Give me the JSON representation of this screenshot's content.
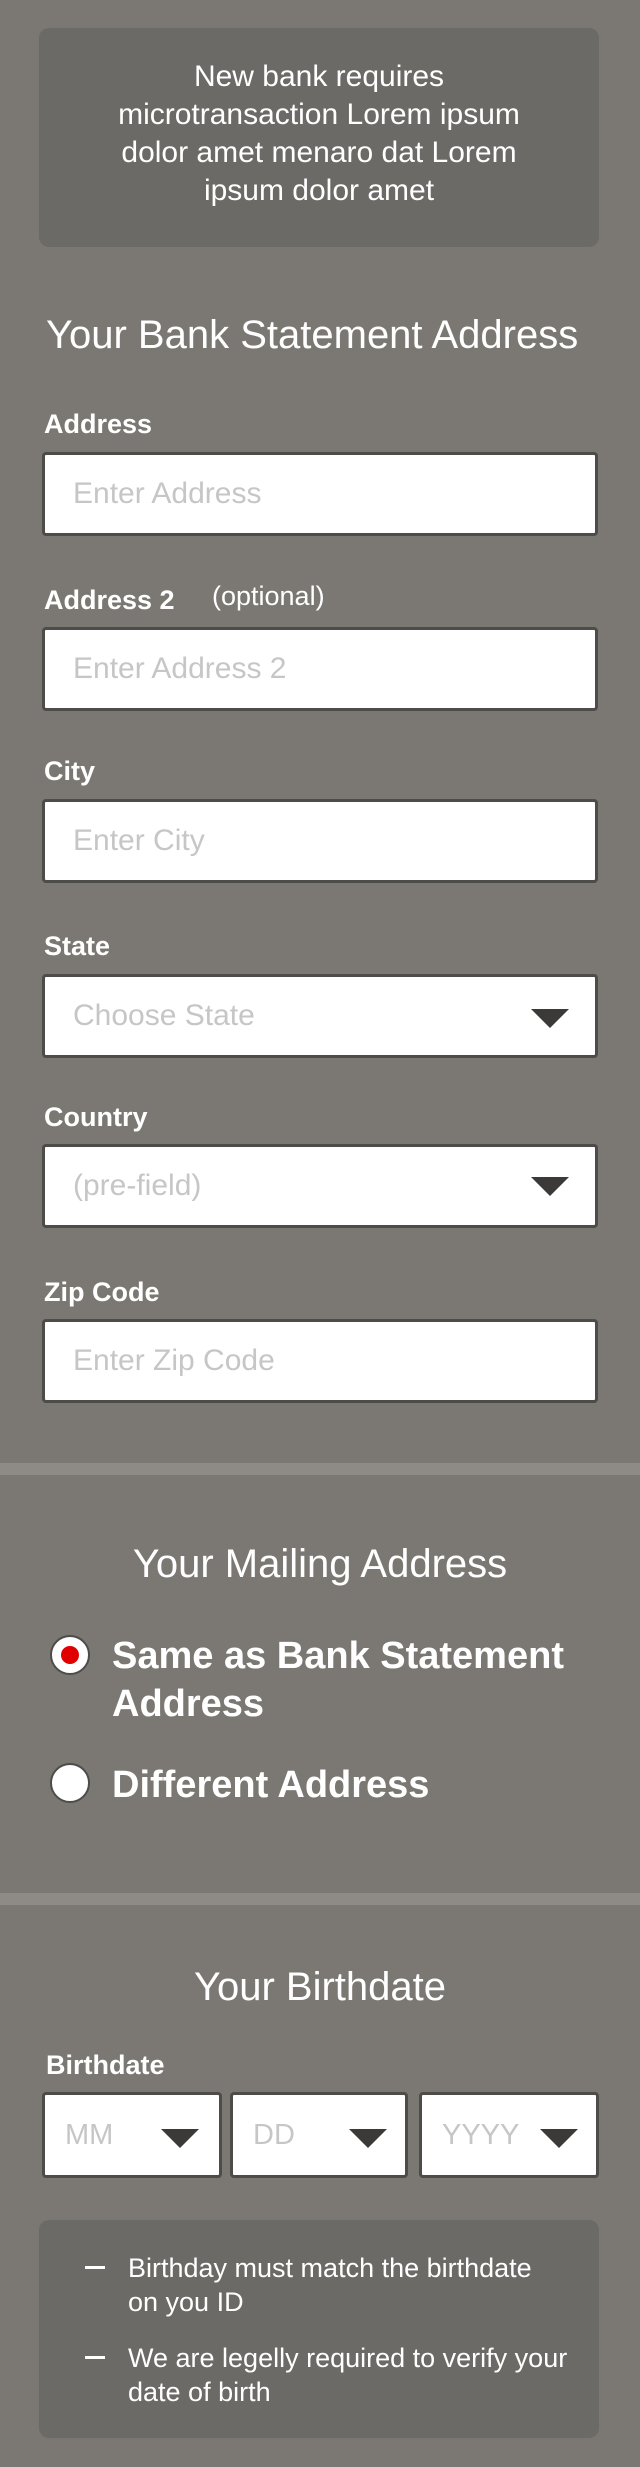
{
  "notice": {
    "text": "New bank requires microtransaction Lorem ipsum dolor amet menaro dat Lorem ipsum dolor amet"
  },
  "bank_section": {
    "title": "Your Bank Statement Address",
    "address_label": "Address",
    "address_placeholder": "Enter Address",
    "address2_label": "Address 2",
    "address2_optional": "(optional)",
    "address2_placeholder": "Enter Address 2",
    "city_label": "City",
    "city_placeholder": "Enter City",
    "state_label": "State",
    "state_placeholder": "Choose State",
    "country_label": "Country",
    "country_placeholder": "(pre-field)",
    "zip_label": "Zip Code",
    "zip_placeholder": "Enter Zip Code"
  },
  "mailing_section": {
    "title": "Your Mailing Address",
    "options": [
      {
        "label_line1": "Same as Bank Statement",
        "label_line2": "Address",
        "selected": true
      },
      {
        "label_line1": "Different Address",
        "selected": false
      }
    ]
  },
  "birth_section": {
    "title": "Your Birthdate",
    "label": "Birthdate",
    "month_placeholder": "MM",
    "day_placeholder": "DD",
    "year_placeholder": "YYYY",
    "notes": [
      "Birthday must match the birthdate on you ID",
      "We are legelly required to verify your date of birth"
    ]
  },
  "colors": {
    "background": "#7b7873",
    "panel": "#6c6a66",
    "radio_selected": "#e00000"
  },
  "icons": {
    "dropdown": "caret-down-icon",
    "bullet": "dash-icon"
  }
}
